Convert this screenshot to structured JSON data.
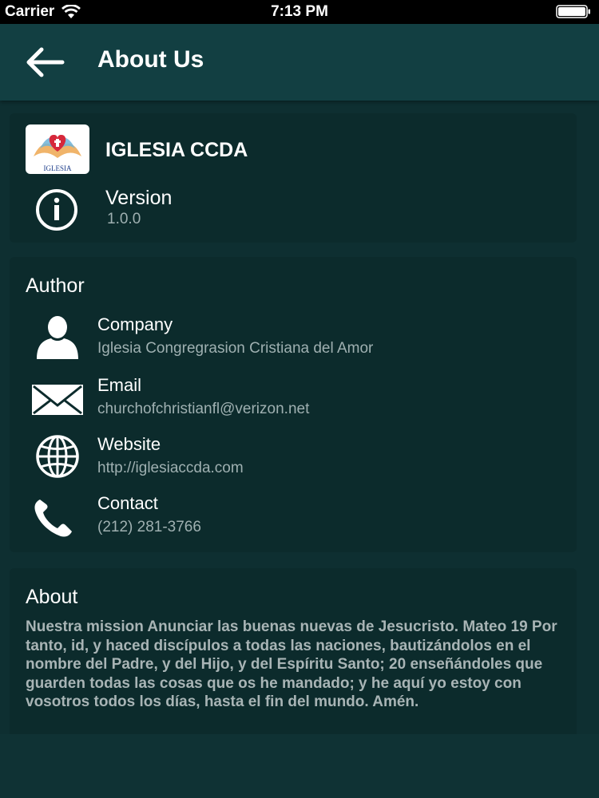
{
  "status_bar": {
    "carrier": "Carrier",
    "time": "7:13 PM",
    "wifi_icon": "wifi-icon",
    "battery_icon": "battery-icon"
  },
  "header": {
    "title": "About Us",
    "back_icon": "back-arrow-icon"
  },
  "app_card": {
    "app_name": "IGLESIA CCDA",
    "logo_text": "IGLESIA",
    "version_label": "Version",
    "version_value": "1.0.0",
    "icon": "info-icon"
  },
  "author": {
    "title": "Author",
    "rows": [
      {
        "label": "Company",
        "value": "Iglesia Congregrasion Cristiana del Amor",
        "icon": "person-icon"
      },
      {
        "label": "Email",
        "value": "churchofchristianfl@verizon.net",
        "icon": "envelope-icon"
      },
      {
        "label": "Website",
        "value": "http://iglesiaccda.com",
        "icon": "globe-icon"
      },
      {
        "label": "Contact",
        "value": "(212) 281-3766",
        "icon": "phone-icon"
      }
    ]
  },
  "about": {
    "title": "About",
    "text": "Nuestra mission Anunciar las buenas nuevas de Jesucristo. Mateo 19 Por tanto, id, y haced discípulos a todas las naciones, bautizándolos en el nombre del Padre, y del Hijo, y del Espíritu Santo; 20 enseñándoles que guarden todas las cosas que os he mandado; y he aquí yo estoy con vosotros todos los días, hasta el fin del mundo. Amén."
  },
  "colors": {
    "background": "#0e2f31",
    "nav_bar": "#123f42",
    "card": "#0c2b2c",
    "secondary_text": "#9fb0b1"
  }
}
